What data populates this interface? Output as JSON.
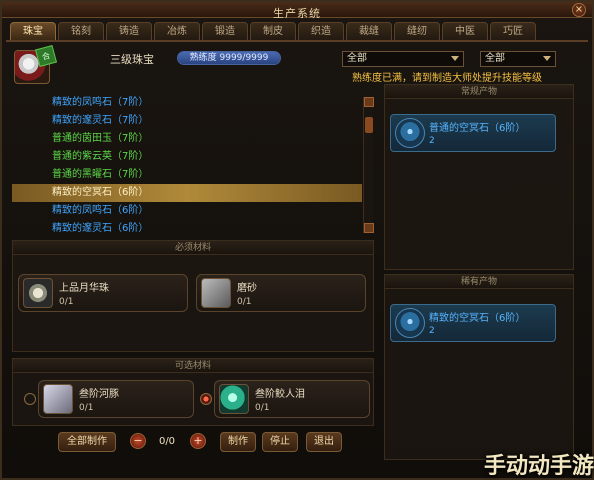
{
  "window": {
    "title": "生产系统",
    "close_label": "×"
  },
  "tabs": [
    {
      "label": "珠宝",
      "active": true
    },
    {
      "label": "铭刻"
    },
    {
      "label": "铸造"
    },
    {
      "label": "冶炼"
    },
    {
      "label": "锻造"
    },
    {
      "label": "制皮"
    },
    {
      "label": "织造"
    },
    {
      "label": "裁缝"
    },
    {
      "label": "缝纫"
    },
    {
      "label": "中医"
    },
    {
      "label": "巧匠"
    }
  ],
  "skill": {
    "name": "三级珠宝",
    "proficiency_text": "熟练度 9999/9999",
    "proficiency_fraction": 1.0,
    "icon_tag": "合"
  },
  "filters": {
    "left": {
      "value": "全部"
    },
    "right": {
      "value": "全部"
    }
  },
  "notice": "熟练度已满，请到制造大师处提升技能等级",
  "recipes": [
    {
      "name": "精致的凤鸣石（7阶）",
      "color": "blue"
    },
    {
      "name": "精致的邃灵石（7阶）",
      "color": "blue"
    },
    {
      "name": "普通的茵田玉（7阶）",
      "color": "green"
    },
    {
      "name": "普通的紫云英（7阶）",
      "color": "green"
    },
    {
      "name": "普通的黑曜石（7阶）",
      "color": "green"
    },
    {
      "name": "精致的空冥石（6阶）",
      "color": "selected"
    },
    {
      "name": "精致的凤鸣石（6阶）",
      "color": "blue"
    },
    {
      "name": "精致的邃灵石（6阶）",
      "color": "blue"
    }
  ],
  "required_materials": {
    "header": "必须材料",
    "items": [
      {
        "name": "上品月华珠",
        "count": "0/1",
        "icon": "pearl-icon"
      },
      {
        "name": "磨砂",
        "count": "0/1",
        "icon": "sand-icon"
      }
    ]
  },
  "optional_materials": {
    "header": "可选材料",
    "items": [
      {
        "name": "叁阶河豚",
        "count": "0/1",
        "icon": "fish-icon",
        "selected": false
      },
      {
        "name": "叁阶鲛人泪",
        "count": "0/1",
        "icon": "tear-icon",
        "selected": true
      }
    ]
  },
  "products": {
    "normal": {
      "header": "常规产物",
      "name": "普通的空冥石（6阶）",
      "count": "2"
    },
    "rare": {
      "header": "稀有产物",
      "name": "精致的空冥石（6阶）",
      "count": "2"
    }
  },
  "actions": {
    "make_all": "全部制作",
    "minus": "−",
    "quantity": "0/0",
    "plus": "+",
    "make": "制作",
    "stop": "停止",
    "exit": "退出"
  },
  "watermark": "手动动手游",
  "colors": {
    "green_text": "#5dd84a",
    "blue_text": "#3fa6ff",
    "notice": "#f4c040",
    "accent_gold": "#b08a3a"
  }
}
